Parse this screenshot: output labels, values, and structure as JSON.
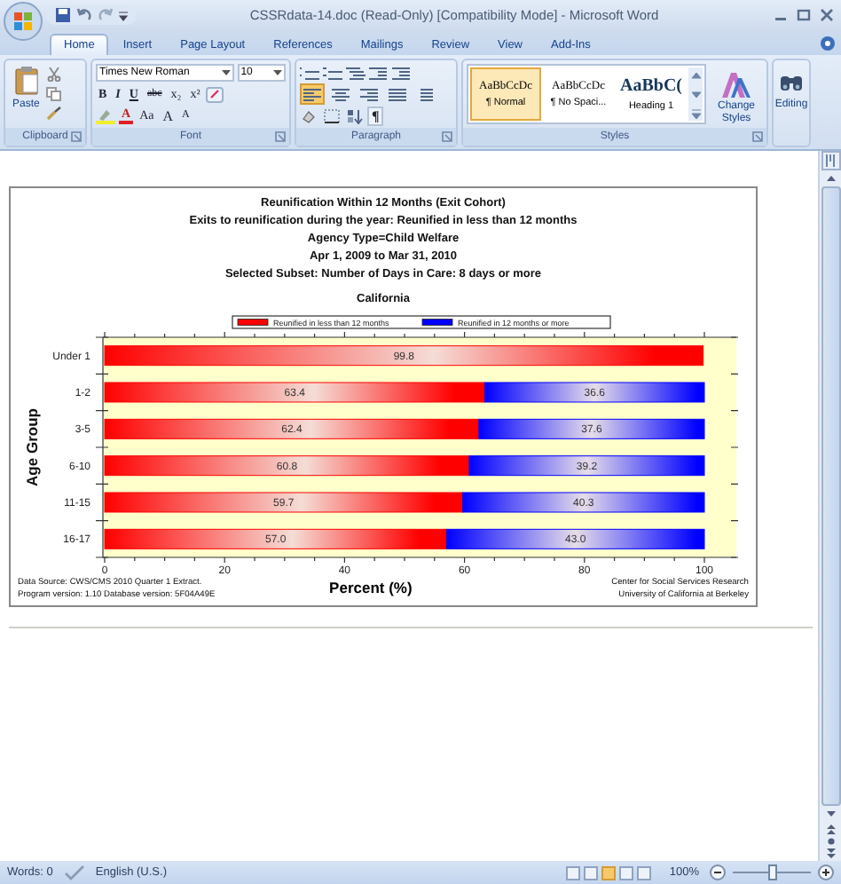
{
  "window": {
    "title": "CSSRdata-14.doc (Read-Only) [Compatibility Mode] - Microsoft Word"
  },
  "tabs": [
    {
      "label": "Home",
      "selected": true
    },
    {
      "label": "Insert",
      "selected": false
    },
    {
      "label": "Page Layout",
      "selected": false
    },
    {
      "label": "References",
      "selected": false
    },
    {
      "label": "Mailings",
      "selected": false
    },
    {
      "label": "Review",
      "selected": false
    },
    {
      "label": "View",
      "selected": false
    },
    {
      "label": "Add-Ins",
      "selected": false
    }
  ],
  "ribbon": {
    "clipboard": {
      "paste": "Paste",
      "label": "Clipboard"
    },
    "font": {
      "font_name": "Times New Roman",
      "font_size": "10",
      "label": "Font",
      "format_buttons": [
        {
          "text": "B",
          "kind": "bold"
        },
        {
          "text": "I",
          "kind": "italic"
        },
        {
          "text": "U",
          "kind": "underline"
        },
        {
          "text": "abc",
          "kind": "strike"
        },
        {
          "text": "x₂",
          "kind": "plain"
        },
        {
          "text": "x²",
          "kind": "plain"
        }
      ],
      "size_buttons": [
        {
          "text": "A",
          "kind": "color"
        },
        {
          "text": "Aa",
          "kind": "plain"
        },
        {
          "text": "A",
          "kind": "grow"
        },
        {
          "text": "A",
          "kind": "shrink"
        }
      ]
    },
    "paragraph": {
      "label": "Paragraph",
      "pilcrow": "¶",
      "align_buttons": [
        {
          "kind": "left",
          "selected": true
        },
        {
          "kind": "center",
          "selected": false
        },
        {
          "kind": "right",
          "selected": false
        },
        {
          "kind": "justify",
          "selected": false
        }
      ]
    },
    "styles": {
      "label": "Styles",
      "change_styles": "Change Styles",
      "items": [
        {
          "sample": "AaBbCcDc",
          "name": "¶ Normal",
          "kind": "normal",
          "selected": true
        },
        {
          "sample": "AaBbCcDc",
          "name": "¶ No Spaci...",
          "kind": "normal",
          "selected": false
        },
        {
          "sample": "AaBbC(",
          "name": "Heading 1",
          "kind": "heading",
          "selected": false
        }
      ]
    },
    "editing": {
      "label": "Editing"
    }
  },
  "document": {
    "chart": {
      "subtitles": [
        "Exits to reunification during the year: Reunified in less than 12 months",
        "Agency Type=Child Welfare",
        "Apr 1, 2009 to Mar 31, 2010",
        "Selected Subset: Number of Days in Care:  8 days or more"
      ],
      "region": "California",
      "chart_data": {
        "type": "bar",
        "orientation": "horizontal",
        "stacked": true,
        "title": "Reunification Within 12 Months (Exit Cohort)",
        "xlabel": "Percent (%)",
        "ylabel": "Age Group",
        "categories": [
          "Under 1",
          "1-2",
          "3-5",
          "6-10",
          "11-15",
          "16-17"
        ],
        "series": [
          {
            "name": "Reunified in less than 12 months",
            "color": "#ff0000",
            "values": [
              99.8,
              63.4,
              62.4,
              60.8,
              59.7,
              57.0
            ],
            "value_labels": [
              "99.8",
              "63.4",
              "62.4",
              "60.8",
              "59.7",
              "57.0"
            ]
          },
          {
            "name": "Reunified in 12 months or more",
            "color": "#0000ff",
            "values": [
              null,
              36.6,
              37.6,
              39.2,
              40.3,
              43.0
            ],
            "value_labels": [
              null,
              "36.6",
              "37.6",
              "39.2",
              "40.3",
              "43.0"
            ]
          }
        ],
        "xlim": [
          0,
          100
        ],
        "xticks": [
          0,
          20,
          40,
          60,
          80,
          100
        ],
        "data_labels": true,
        "legend": "top"
      },
      "source_notes": [
        "Data Source: CWS/CMS 2010 Quarter 1 Extract.",
        "Program version: 1.10 Database version: 5F04A49E"
      ],
      "credits": [
        "Center for Social Services Research",
        "University of California at Berkeley"
      ]
    }
  },
  "status_bar": {
    "words": "Words: 0",
    "language": "English (U.S.)",
    "zoom": "100%",
    "zoom_slider": {
      "level": 0.5
    },
    "views": [
      {
        "selected": false
      },
      {
        "selected": false
      },
      {
        "selected": true
      },
      {
        "selected": false
      },
      {
        "selected": false
      }
    ]
  }
}
